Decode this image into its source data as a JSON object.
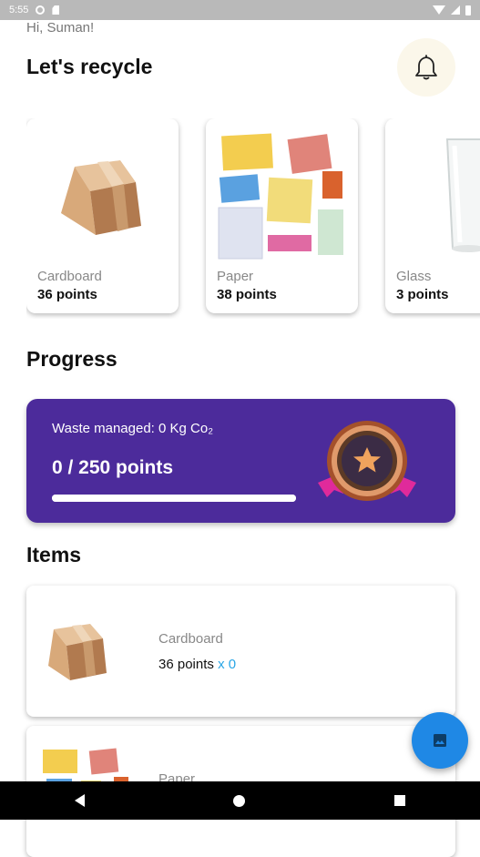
{
  "status_bar": {
    "time": "5:55"
  },
  "greeting": "Hi, Suman!",
  "title": "Let's recycle",
  "categories": [
    {
      "label": "Cardboard",
      "points": "36 points"
    },
    {
      "label": "Paper",
      "points": "38 points"
    },
    {
      "label": "Glass",
      "points": "3 points"
    }
  ],
  "progress": {
    "section_title": "Progress",
    "waste_text": "Waste managed: 0 Kg Co₂",
    "points_text": "0 / 250 points",
    "fill_fraction": 1.0
  },
  "items": {
    "section_title": "Items",
    "list": [
      {
        "name": "Cardboard",
        "points": "36 points",
        "multiplier": "x 0"
      },
      {
        "name": "Paper",
        "points": "",
        "multiplier": ""
      }
    ]
  },
  "colors": {
    "accent_purple": "#4c2b9b",
    "fab_blue": "#1f88e5",
    "multiplier_blue": "#29a6e6"
  },
  "icons": {
    "notification": "bell-icon",
    "fab": "image-icon"
  }
}
